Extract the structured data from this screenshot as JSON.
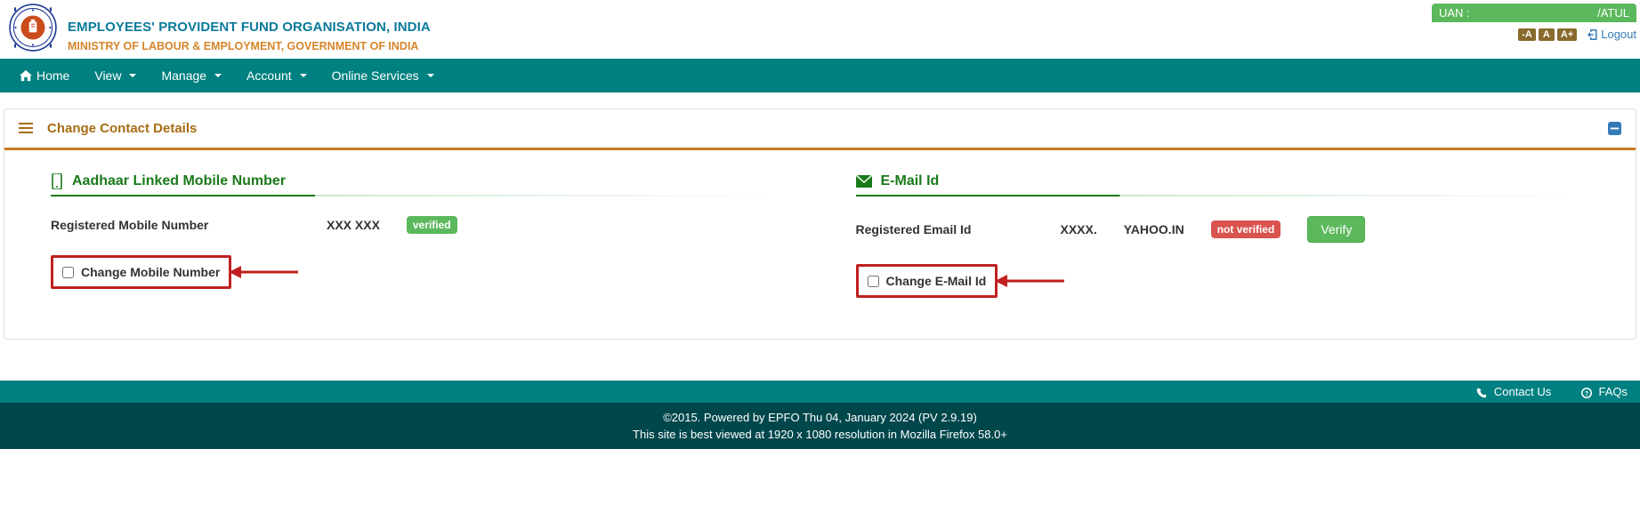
{
  "header": {
    "org_title": "EMPLOYEES' PROVIDENT FUND ORGANISATION, INDIA",
    "org_sub": "MINISTRY OF LABOUR & EMPLOYMENT, GOVERNMENT OF INDIA",
    "uan_label": "UAN :",
    "uan_name": "/ATUL",
    "font_dec": "-A",
    "font_norm": "A",
    "font_inc": "A+",
    "logout": "Logout"
  },
  "nav": {
    "home": "Home",
    "view": "View",
    "manage": "Manage",
    "account": "Account",
    "online": "Online Services"
  },
  "panel": {
    "title": "Change Contact Details",
    "mobile": {
      "section_title": "Aadhaar Linked Mobile Number",
      "label": "Registered Mobile Number",
      "value": "XXX XXX",
      "status": "verified",
      "checkbox_label": "Change Mobile Number"
    },
    "email": {
      "section_title": "E-Mail Id",
      "label": "Registered Email Id",
      "value_local": "XXXX.",
      "value_domain": "YAHOO.IN",
      "status": "not verified",
      "verify_btn": "Verify",
      "checkbox_label": "Change E-Mail Id"
    }
  },
  "footer": {
    "contact": "Contact Us",
    "faq": "FAQs",
    "copyright": "©2015. Powered by EPFO Thu 04, January 2024 (PV 2.9.19)",
    "viewed": "This site is best viewed at 1920 x 1080 resolution in Mozilla Firefox 58.0+"
  }
}
